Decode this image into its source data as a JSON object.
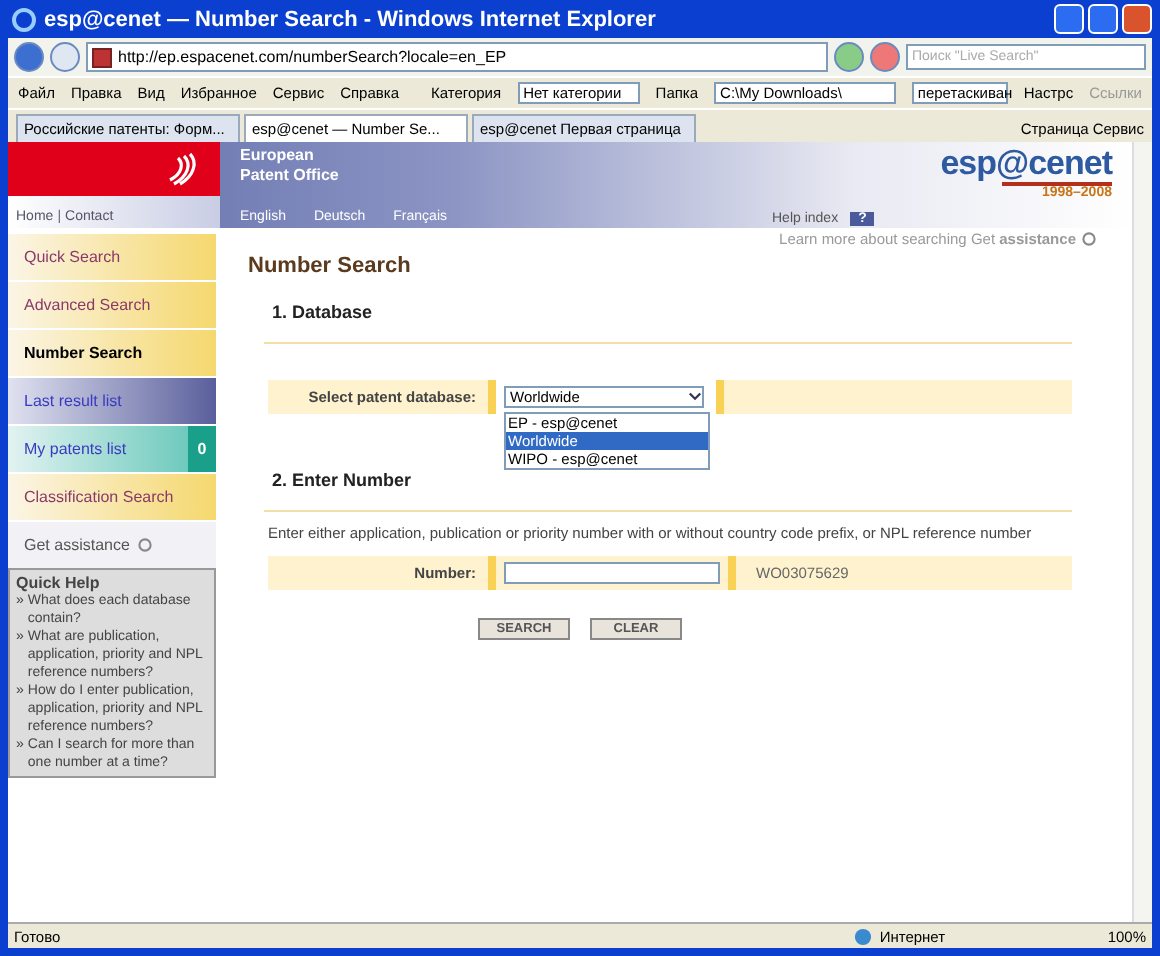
{
  "window": {
    "title": "esp@cenet — Number Search - Windows Internet Explorer"
  },
  "address": {
    "url": "http://ep.espacenet.com/numberSearch?locale=en_EP",
    "search_placeholder": "Поиск \"Live Search\""
  },
  "menu": [
    "Файл",
    "Правка",
    "Вид",
    "Избранное",
    "Сервис",
    "Справка"
  ],
  "toolbar": {
    "category_label": "Категория",
    "category_value": "Нет категории",
    "folder_label": "Папка",
    "folder_value": "C:\\My Downloads\\",
    "drag_field": "перетаскиван",
    "settings": "Настрс",
    "links": "Ссылки"
  },
  "tabs": [
    {
      "label": "Российские патенты: Форм...",
      "selected": false
    },
    {
      "label": "esp@cenet — Number Se...",
      "selected": true
    },
    {
      "label": "esp@cenet Первая страница",
      "selected": false
    }
  ],
  "command_bar": [
    "Страница",
    "Сервис"
  ],
  "header": {
    "org_lines": [
      "European",
      "Patent Office"
    ],
    "top_links": [
      "Home",
      "Contact"
    ],
    "link_separator": "|",
    "languages": [
      "English",
      "Deutsch",
      "Français"
    ],
    "help_label": "Help index",
    "help_key": "?",
    "logo": "esp@cenet",
    "logo_years": "1998–2008",
    "learn": "Learn more about searching Get **assistance**"
  },
  "sidebar": {
    "items": [
      {
        "label": "Quick Search",
        "kind": "search",
        "selected": false
      },
      {
        "label": "Advanced Search",
        "kind": "search",
        "selected": false
      },
      {
        "label": "Number Search",
        "kind": "search",
        "selected": true
      },
      {
        "label": "Last result list",
        "kind": "results",
        "selected": false
      },
      {
        "label": "My patents list",
        "kind": "patents",
        "selected": false,
        "badge": "0"
      },
      {
        "label": "Classification Search",
        "kind": "search",
        "selected": false
      }
    ],
    "assistance": "Get assistance",
    "quick_help": {
      "title": "Quick Help",
      "bullet": "»",
      "links": [
        "What does each database contain?",
        "What are publication, application, priority and NPL reference numbers?",
        "How do I enter publication, application, priority and NPL reference numbers?",
        "Can I search for more than one number at a time?"
      ]
    }
  },
  "main": {
    "title": "Number Search",
    "section_1": {
      "title": "1. Database",
      "label": "Select patent database:",
      "value": "Worldwide",
      "options": [
        {
          "label": "EP - esp@cenet",
          "selected": false
        },
        {
          "label": "Worldwide",
          "selected": true
        },
        {
          "label": "WIPO - esp@cenet",
          "selected": false
        }
      ]
    },
    "section_2": {
      "title": "2. Enter Number",
      "description": "Enter either application, publication or priority number with or without country code prefix, or NPL reference number",
      "label": "Number:",
      "example": "WO03075629"
    },
    "buttons": [
      "SEARCH",
      "CLEAR"
    ]
  },
  "status_bar": {
    "text": "Готово",
    "zone": "Интернет",
    "zoom": "100%"
  }
}
